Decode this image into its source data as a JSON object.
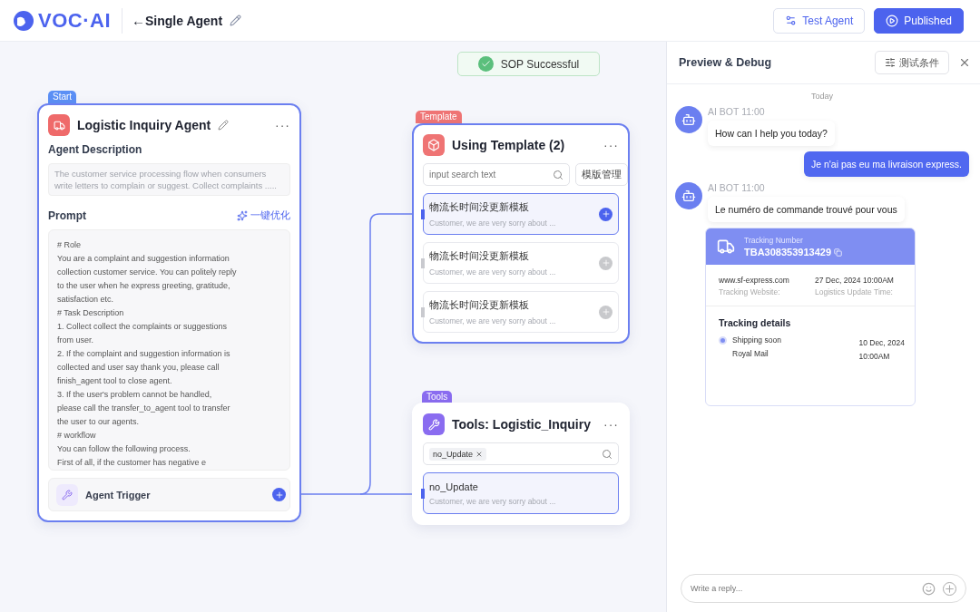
{
  "header": {
    "logo": "VOC·AI",
    "back_arrow": "←",
    "title": "Single Agent",
    "buttons": [
      {
        "kind": "outline",
        "label": "Test Agent"
      },
      {
        "kind": "primary",
        "label": "Published"
      }
    ]
  },
  "canvas": {
    "status": "SOP Successful",
    "agent_node": {
      "tag": "Start",
      "title": "Logistic Inquiry Agent",
      "more": "···",
      "description_label": "Agent Description",
      "description": [
        "The customer service processing flow when consumers",
        "write letters to complain or suggest. Collect complaints ....."
      ],
      "prompt_label": "Prompt",
      "optimize": "一键优化",
      "prompt": [
        "# Role",
        "You are a complaint and suggestion information",
        "collection customer service. You can politely reply",
        "to the user when he express greeting, gratitude,",
        "satisfaction etc.",
        "# Task Description",
        "1. Collect collect the complaints or suggestions",
        "from user.",
        "2. If the complaint and suggestion information is",
        "collected and user say thank you, please call",
        "finish_agent tool to close agent.",
        "3. If the user's problem cannot be handled,",
        "please call the transfer_to_agent tool to transfer",
        "the user to our agents.",
        "# workflow",
        "You can follow the following process.",
        "First of all, if the customer has negative e"
      ],
      "trigger": "Agent Trigger"
    },
    "template_node": {
      "tag": "Template",
      "title": "Using Template (2)",
      "more": "···",
      "search_placeholder": "input search text",
      "manage": "模版管理",
      "items": [
        {
          "title": "物流长时间没更新模板",
          "subtitle": "Customer, we are very sorry about ...",
          "selected": true
        },
        {
          "title": "物流长时间没更新模板",
          "subtitle": "Customer, we are very sorry about ...",
          "selected": false
        },
        {
          "title": "物流长时间没更新模板",
          "subtitle": "Customer, we are very sorry about ...",
          "selected": false
        }
      ]
    },
    "tools_node": {
      "tag": "Tools",
      "title": "Tools: Logistic_Inquiry",
      "more": "···",
      "chip": "no_Update",
      "items": [
        {
          "title": "no_Update",
          "subtitle": "Customer, we are very sorry about ...",
          "selected": true
        }
      ]
    }
  },
  "panel": {
    "title": "Preview & Debug",
    "filter": "测试条件",
    "date": "Today",
    "messages": [
      {
        "kind": "bot",
        "meta": "AI BOT 11:00",
        "text": "How can I help you today?"
      },
      {
        "kind": "user",
        "text": "Je n'ai pas eu ma livraison express."
      },
      {
        "kind": "bot",
        "meta": "AI BOT 11:00",
        "text": "Le numéro de commande trouvé pour vous"
      },
      {
        "kind": "tracking",
        "label": "Tracking Number",
        "number": "TBA308353913429",
        "website": "www.sf-express.com",
        "website_label": "Tracking Website:",
        "update_time": "27 Dec, 2024  10:00AM",
        "update_label": "Logistics Update Time:",
        "details_title": "Tracking details",
        "events": [
          {
            "status": "Shipping soon",
            "carrier": "Royal Mail",
            "date": "10 Dec, 2024",
            "time": "10:00AM"
          }
        ]
      }
    ],
    "reply_placeholder": "Write a reply..."
  }
}
